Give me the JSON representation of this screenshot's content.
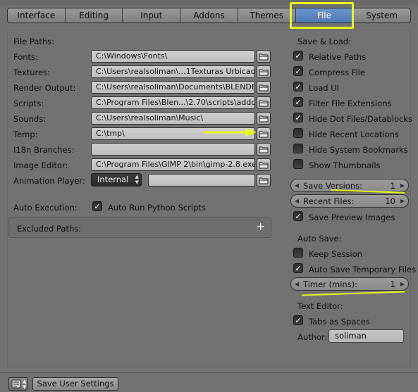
{
  "tabs": [
    {
      "label": "Interface"
    },
    {
      "label": "Editing"
    },
    {
      "label": "Input"
    },
    {
      "label": "Addons"
    },
    {
      "label": "Themes"
    },
    {
      "label": "File"
    },
    {
      "label": "System"
    }
  ],
  "active_tab": "File",
  "file_paths": {
    "header": "File Paths:",
    "fonts": {
      "label": "Fonts:",
      "value": "C:\\Windows\\Fonts\\"
    },
    "textures": {
      "label": "Textures:",
      "value": "C:\\Users\\realsoliman\\...1Texturas Urbicad2\\"
    },
    "render_output": {
      "label": "Render Output:",
      "value": "C:\\Users\\realsoliman\\Documents\\BLENDER\\"
    },
    "scripts": {
      "label": "Scripts:",
      "value": "C:\\Program Files\\Blen...\\2.70\\scripts\\addons\\"
    },
    "sounds": {
      "label": "Sounds:",
      "value": "C:\\Users\\realsoliman\\Music\\"
    },
    "temp": {
      "label": "Temp:",
      "value": "C:\\tmp\\"
    },
    "i18n": {
      "label": "I18n Branches:",
      "value": ""
    },
    "image_editor": {
      "label": "Image Editor:",
      "value": "C:\\Program Files\\GIMP 2\\bin\\gimp-2.8.exe"
    },
    "animation_player": {
      "label": "Animation Player:",
      "dropdown": "Internal",
      "value": ""
    }
  },
  "auto_execution": {
    "label": "Auto Execution:",
    "checkbox_label": "Auto Run Python Scripts",
    "checked": true,
    "excluded_paths_label": "Excluded Paths:",
    "add_symbol": "+"
  },
  "save_load": {
    "header": "Save & Load:",
    "options": [
      {
        "label": "Relative Paths",
        "checked": true
      },
      {
        "label": "Compress File",
        "checked": true
      },
      {
        "label": "Load UI",
        "checked": true
      },
      {
        "label": "Filter File Extensions",
        "checked": true
      },
      {
        "label": "Hide Dot Files/Datablocks",
        "checked": true
      },
      {
        "label": "Hide Recent Locations",
        "checked": false
      },
      {
        "label": "Hide System Bookmarks",
        "checked": false
      },
      {
        "label": "Show Thumbnails",
        "checked": false
      }
    ],
    "save_versions": {
      "label": "Save Versions:",
      "value": "1"
    },
    "recent_files": {
      "label": "Recent Files:",
      "value": "10"
    },
    "save_preview": {
      "label": "Save Preview Images",
      "checked": true
    }
  },
  "auto_save": {
    "header": "Auto Save:",
    "keep_session": {
      "label": "Keep Session",
      "checked": false
    },
    "auto_save_temp": {
      "label": "Auto Save Temporary Files",
      "checked": true
    },
    "timer": {
      "label": "Timer (mins):",
      "value": "1"
    }
  },
  "text_editor": {
    "header": "Text Editor:",
    "tabs_as_spaces": {
      "label": "Tabs as Spaces",
      "checked": true
    },
    "author": {
      "label": "Author:",
      "value": "soliman"
    }
  },
  "bottom": {
    "save_button": "Save User Settings"
  },
  "colors": {
    "background": "#727272",
    "active_tab": "#5a86c3",
    "annotation": "#e8f81a"
  },
  "icons": {
    "folder": "folder-icon",
    "check": "✓",
    "arrow_left": "◀",
    "arrow_right": "▶"
  }
}
